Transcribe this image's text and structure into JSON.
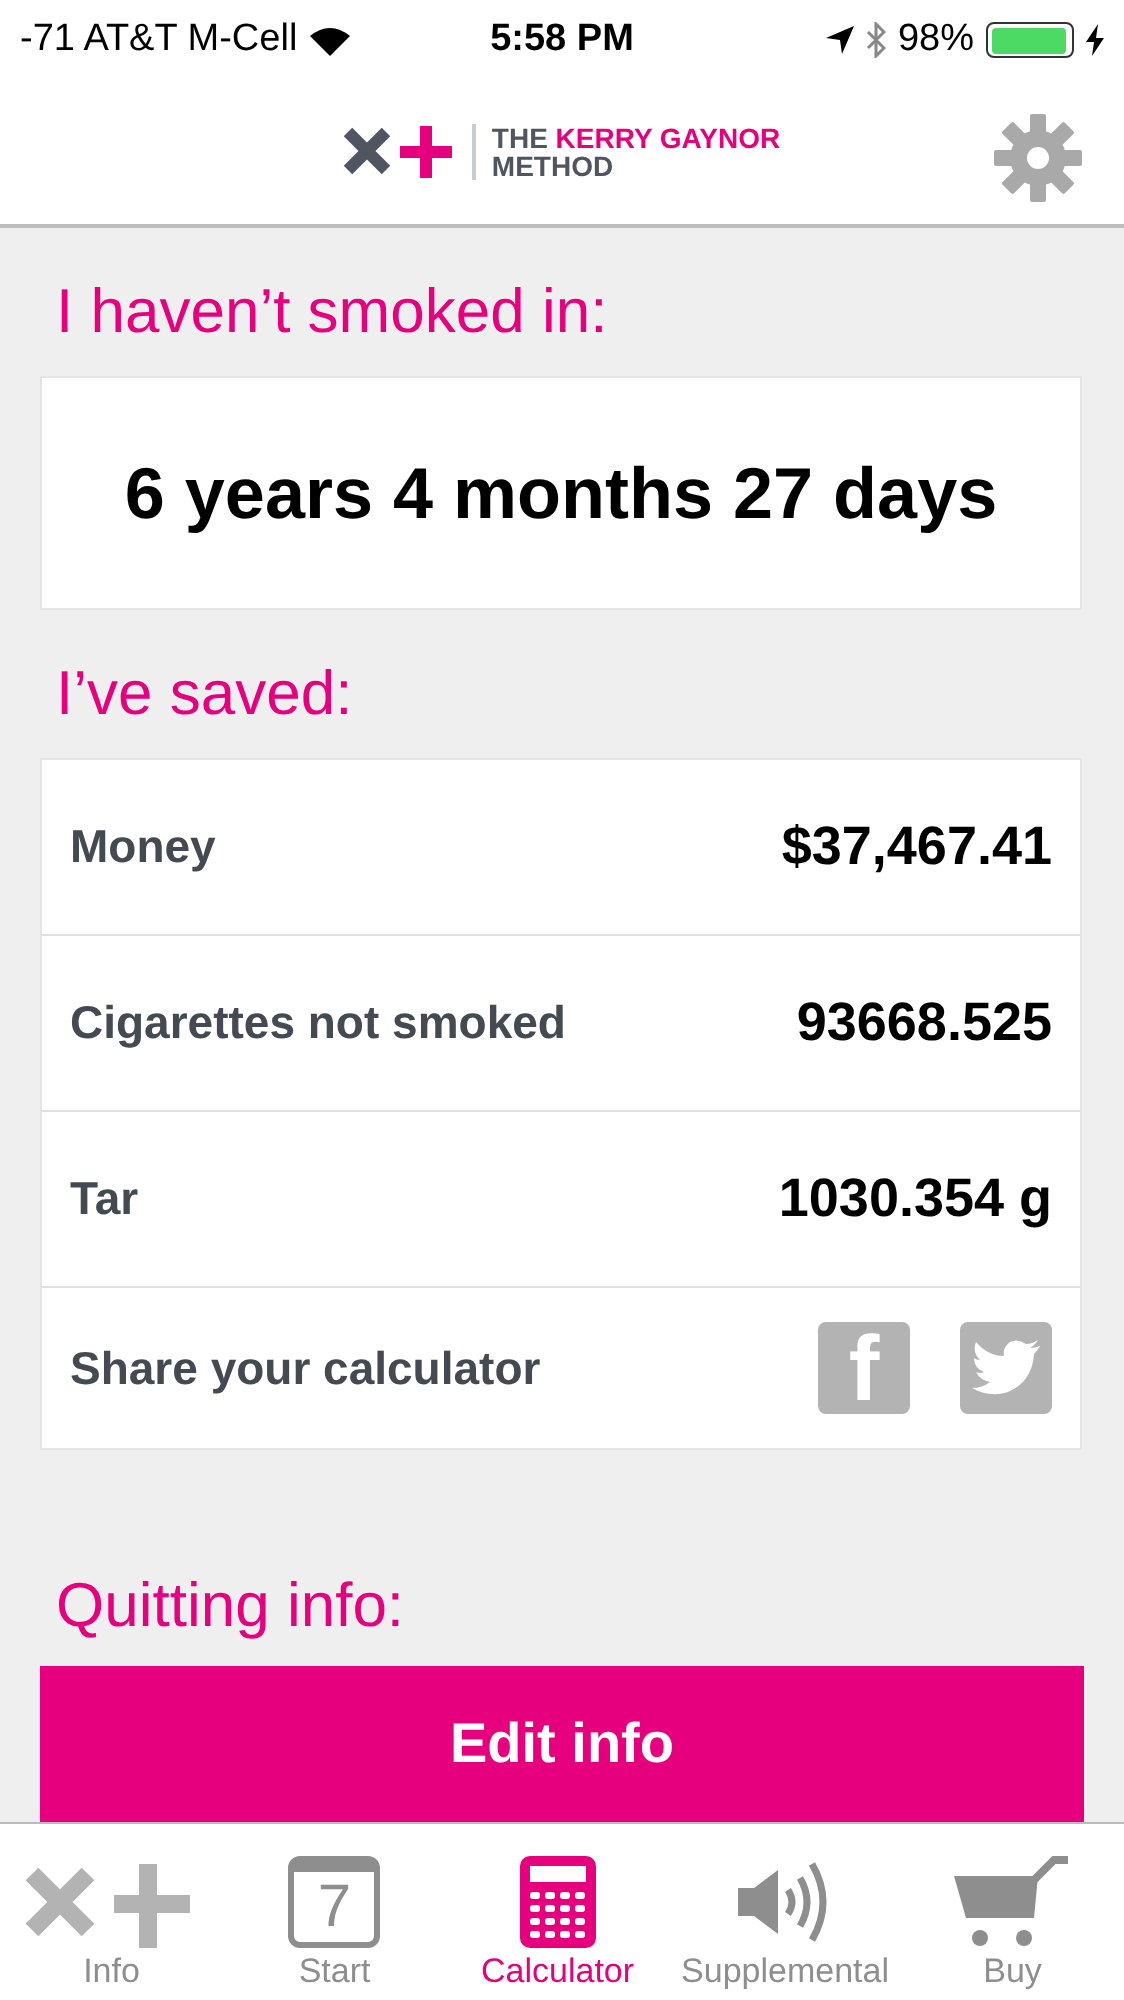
{
  "status_bar": {
    "carrier": "-71 AT&T M-Cell",
    "time": "5:58 PM",
    "battery": "98%"
  },
  "header": {
    "logo_the": "THE",
    "logo_name": "KERRY GAYNOR",
    "logo_method": "METHOD"
  },
  "smoke_free": {
    "heading": "I haven’t smoked in:",
    "duration": "6 years 4 months 27 days"
  },
  "savings": {
    "heading": "I’ve saved:",
    "rows": [
      {
        "label": "Money",
        "value": "$37,467.41"
      },
      {
        "label": "Cigarettes not smoked",
        "value": "93668.525"
      },
      {
        "label": "Tar",
        "value": "1030.354 g"
      }
    ],
    "share_label": "Share your calculator",
    "facebook_glyph": "f"
  },
  "quitting": {
    "heading": "Quitting info:",
    "button": "Edit info"
  },
  "tabs": [
    {
      "kind": "info",
      "label": "Info",
      "selected": false
    },
    {
      "kind": "calendar",
      "label": "Start",
      "selected": false,
      "glyph": "7"
    },
    {
      "kind": "calculator",
      "label": "Calculator",
      "selected": true
    },
    {
      "kind": "speaker",
      "label": "Supplemental",
      "selected": false
    },
    {
      "kind": "cart",
      "label": "Buy",
      "selected": false
    }
  ]
}
